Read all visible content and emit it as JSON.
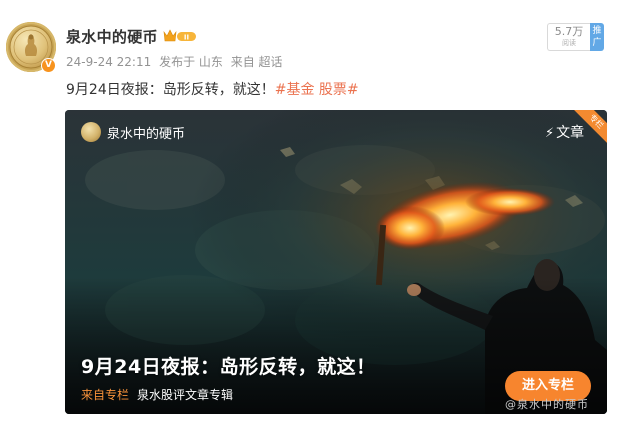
{
  "user": {
    "name": "泉水中的硬币",
    "member_badge": "II",
    "verified_icon": "v-verified-icon",
    "avatar_icon": "gold-coin-avatar"
  },
  "meta": {
    "time": "24-9-24 22:11",
    "location": "发布于 山东",
    "source": "来自 超话"
  },
  "stats": {
    "views": "5.7万",
    "views_label": "阅读",
    "promote": "推广"
  },
  "post": {
    "text": "9月24日夜报：岛形反转，就这！",
    "tags": "#基金 股票#"
  },
  "card": {
    "author": "泉水中的硬币",
    "type_icon": "lightning-icon",
    "type_label": "文章",
    "corner_label": "专栏",
    "title": "9月24日夜报：岛形反转，就这！",
    "source_from": "来自专栏",
    "source_name": "泉水股评文章专辑",
    "button": "进入专栏"
  },
  "watermark": "@泉水中的硬币",
  "colors": {
    "accent_orange": "#f7852e",
    "tag_color": "#eb7350",
    "meta_gray": "#939393",
    "promote_blue": "#62a8e6"
  }
}
